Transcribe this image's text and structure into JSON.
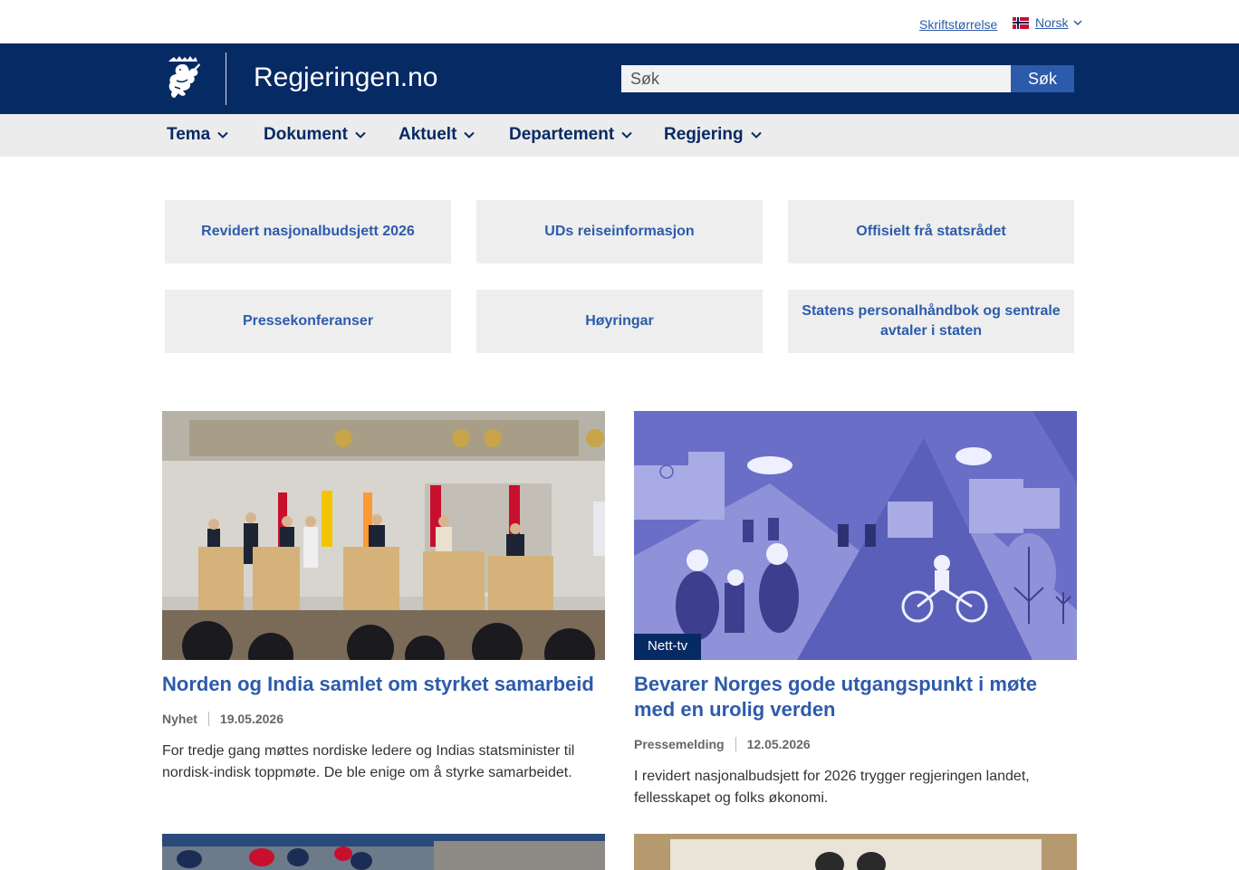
{
  "utility": {
    "font_size_label": "Skriftstørrelse",
    "language_label": "Norsk"
  },
  "header": {
    "site_title": "Regjeringen.no",
    "search_placeholder": "Søk",
    "search_button": "Søk"
  },
  "nav": {
    "items": [
      {
        "label": "Tema"
      },
      {
        "label": "Dokument"
      },
      {
        "label": "Aktuelt"
      },
      {
        "label": "Departement"
      },
      {
        "label": "Regjering"
      }
    ]
  },
  "quick_links": [
    {
      "label": "Revidert nasjonalbudsjett 2026"
    },
    {
      "label": "UDs reiseinformasjon"
    },
    {
      "label": "Offisielt frå statsrådet"
    },
    {
      "label": "Pressekonferanser"
    },
    {
      "label": "Høyringar"
    },
    {
      "label": "Statens personalhåndbok og sentrale avtaler i staten"
    }
  ],
  "news": [
    {
      "title": "Norden og India samlet om styrket samarbeid",
      "type": "Nyhet",
      "date": "19.05.2026",
      "summary": "For tredje gang møttes nordiske ledere og Indias statsminister til nordisk-indisk toppmøte. De ble enige om å styrke samarbeidet."
    },
    {
      "title": "Bevarer Norges gode utgangspunkt i møte med en urolig verden",
      "type": "Pressemelding",
      "date": "12.05.2026",
      "badge": "Nett-tv",
      "summary": "I revidert nasjonalbudsjett for 2026 trygger regjeringen landet, fellesskapet og folks økonomi."
    }
  ],
  "colors": {
    "header_bg": "#062a64",
    "link_blue": "#2d5bab",
    "nav_bg": "#ececec",
    "tile_bg": "#eeeeee",
    "illustration": "#6a6ec7"
  }
}
